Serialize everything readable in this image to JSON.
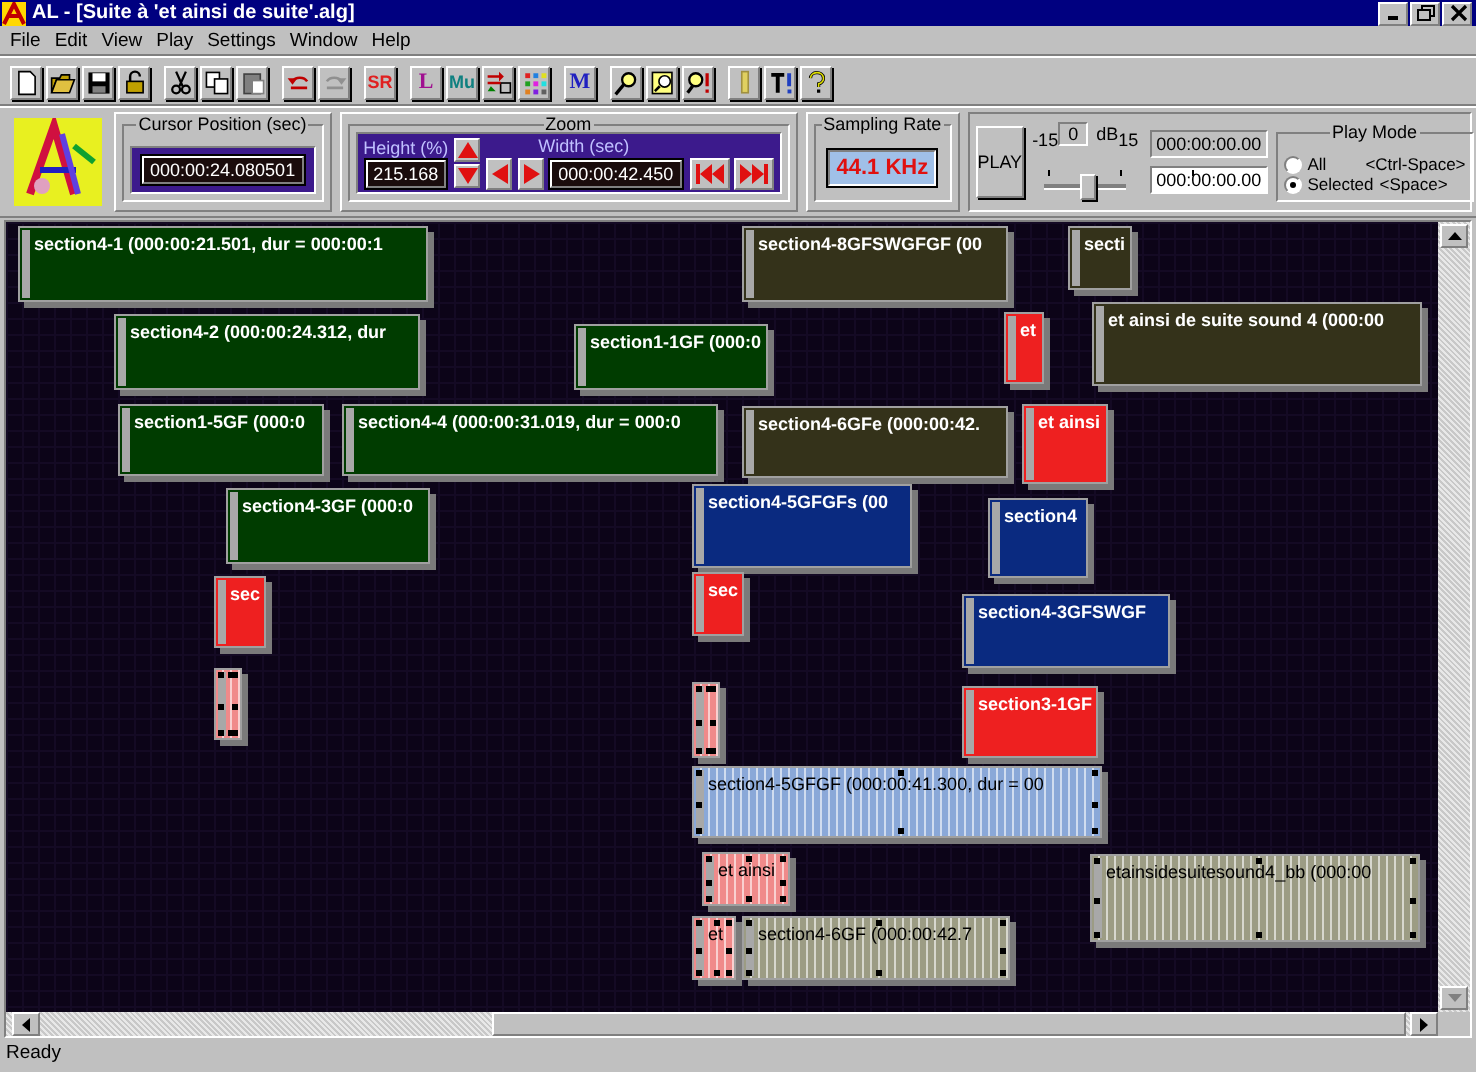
{
  "window": {
    "title": "AL - [Suite à 'et ainsi de suite'.alg]"
  },
  "menu": [
    "File",
    "Edit",
    "View",
    "Play",
    "Settings",
    "Window",
    "Help"
  ],
  "toolbar": [
    {
      "kind": "icon"
    },
    {
      "kind": "icon"
    },
    {
      "kind": "icon"
    },
    {
      "kind": "icon"
    },
    {
      "kind": "gap"
    },
    {
      "kind": "icon"
    },
    {
      "kind": "icon"
    },
    {
      "kind": "icon"
    },
    {
      "kind": "gap"
    },
    {
      "kind": "icon"
    },
    {
      "kind": "icon"
    },
    {
      "kind": "gap"
    },
    {
      "kind": "text",
      "label": "SR",
      "color": "#e02020"
    },
    {
      "kind": "gap"
    },
    {
      "kind": "text",
      "label": "L",
      "color": "#a01090"
    },
    {
      "kind": "text",
      "label": "Mu",
      "color": "#108080"
    },
    {
      "kind": "icon"
    },
    {
      "kind": "icon"
    },
    {
      "kind": "gap"
    },
    {
      "kind": "text",
      "label": "M",
      "color": "#2020c0"
    },
    {
      "kind": "gap"
    },
    {
      "kind": "icon"
    },
    {
      "kind": "icon"
    },
    {
      "kind": "icon"
    },
    {
      "kind": "gap"
    },
    {
      "kind": "icon"
    },
    {
      "kind": "icon"
    },
    {
      "kind": "icon"
    }
  ],
  "cursor_position": {
    "label": "Cursor Position (sec)",
    "value": "000:00:24.080501"
  },
  "zoom": {
    "label": "Zoom",
    "height_label": "Height (%)",
    "height_value": "215.168",
    "width_label": "Width (sec)",
    "width_value": "000:00:42.450"
  },
  "sampling_rate": {
    "label": "Sampling Rate",
    "value": "44.1 KHz"
  },
  "play": {
    "button": "PLAY",
    "scale_min": "-15",
    "db_value": "0",
    "db_unit": "dB",
    "scale_max": "15",
    "level": 0.5,
    "time_start": "000:00:00.00",
    "time_end": "000:00:00.00"
  },
  "play_mode": {
    "label": "Play Mode",
    "options": [
      {
        "label": "All",
        "shortcut": "<Ctrl-Space>",
        "selected": false
      },
      {
        "label": "Selected",
        "shortcut": "<Space>",
        "selected": true
      }
    ]
  },
  "blocks": [
    {
      "label": "section4-1  (000:00:21.501, dur = 000:00:1",
      "color": "#003c00",
      "selected": false
    },
    {
      "label": "section4-2  (000:00:24.312, dur",
      "color": "#003c00",
      "selected": false
    },
    {
      "label": "section1-1GF  (000:0",
      "color": "#003c00",
      "selected": false
    },
    {
      "label": "section1-5GF  (000:0",
      "color": "#003c00",
      "selected": false
    },
    {
      "label": "section4-4  (000:00:31.019, dur = 000:0",
      "color": "#003c00",
      "selected": false
    },
    {
      "label": "section4-3GF  (000:0",
      "color": "#003c00",
      "selected": false
    },
    {
      "label": "section4-8GFSWGFGF  (00",
      "color": "#34321a",
      "selected": false
    },
    {
      "label": "secti",
      "color": "#34321a",
      "selected": false
    },
    {
      "label": "et",
      "color": "#ee2020",
      "selected": false
    },
    {
      "label": "et ainsi de suite sound 4  (000:00",
      "color": "#34321a",
      "selected": false
    },
    {
      "label": "section4-6GFe  (000:00:42.",
      "color": "#34321a",
      "selected": false
    },
    {
      "label": "et ainsi",
      "color": "#ee2020",
      "selected": false
    },
    {
      "label": "section4-5GFGFs  (00",
      "color": "#0a2a80",
      "selected": false
    },
    {
      "label": "section4",
      "color": "#0a2a80",
      "selected": false
    },
    {
      "label": "sec",
      "color": "#ee2020",
      "selected": false
    },
    {
      "label": "sec",
      "color": "#ee2020",
      "selected": false
    },
    {
      "label": "section4-3GFSWGF",
      "color": "#0a2a80",
      "selected": false
    },
    {
      "color": "#f08a8a",
      "selected": true
    },
    {
      "label": "section3-1GF",
      "color": "#ee2020",
      "selected": false
    },
    {
      "color": "#f08a8a",
      "selected": true
    },
    {
      "label": "section4-5GFGF  (000:00:41.300, dur = 00",
      "color": "#8aa8d8",
      "selected": true
    },
    {
      "label": "et ainsi",
      "color": "#f08a8a",
      "selected": true
    },
    {
      "label": "etainsidesuitesound4_bb  (000:00",
      "color": "#9c9c84",
      "selected": true
    },
    {
      "label": "et",
      "color": "#f08a8a",
      "selected": true
    },
    {
      "label": "section4-6GF  (000:00:42.7",
      "color": "#9c9c84",
      "selected": true
    }
  ],
  "status_bar": "Ready"
}
